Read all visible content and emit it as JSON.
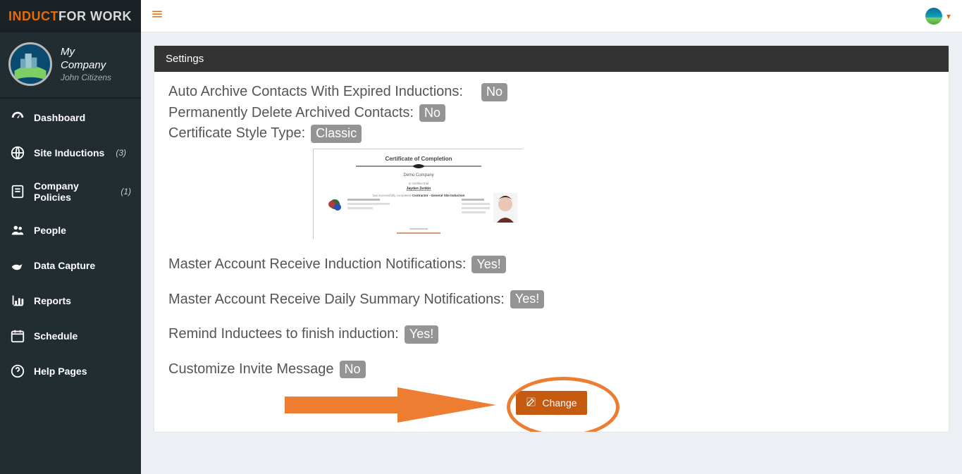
{
  "brand": {
    "part1": "INDUCT",
    "part2": "FOR WORK"
  },
  "user": {
    "company_line1": "My",
    "company_line2": "Company",
    "name": "John Citizens"
  },
  "sidebar": {
    "items": [
      {
        "label": "Dashboard",
        "count": ""
      },
      {
        "label": "Site Inductions",
        "count": "(3)"
      },
      {
        "label": "Company Policies",
        "count": "(1)"
      },
      {
        "label": "People",
        "count": ""
      },
      {
        "label": "Data Capture",
        "count": ""
      },
      {
        "label": "Reports",
        "count": ""
      },
      {
        "label": "Schedule",
        "count": ""
      },
      {
        "label": "Help Pages",
        "count": ""
      }
    ]
  },
  "panel": {
    "title": "Settings"
  },
  "settings": {
    "auto_archive_label": "Auto Archive Contacts With Expired Inductions:",
    "auto_archive_value": "No",
    "perm_delete_label": "Permanently Delete Archived Contacts:",
    "perm_delete_value": "No",
    "cert_style_label": "Certificate Style Type:",
    "cert_style_value": "Classic",
    "master_induct_label": "Master Account Receive Induction Notifications:",
    "master_induct_value": "Yes!",
    "master_daily_label": "Master Account Receive Daily Summary Notifications:",
    "master_daily_value": "Yes!",
    "remind_label": "Remind Inductees to finish induction:",
    "remind_value": "Yes!",
    "custom_invite_label": "Customize Invite Message",
    "custom_invite_value": "No"
  },
  "certificate": {
    "title": "Certificate of Completion",
    "company": "Demo Company",
    "certifies": "Is certifies that",
    "holder": "Jayden Zenkin",
    "completed": "has successfully completed",
    "course": "Contractor - General Site Induction"
  },
  "buttons": {
    "change": "Change"
  }
}
